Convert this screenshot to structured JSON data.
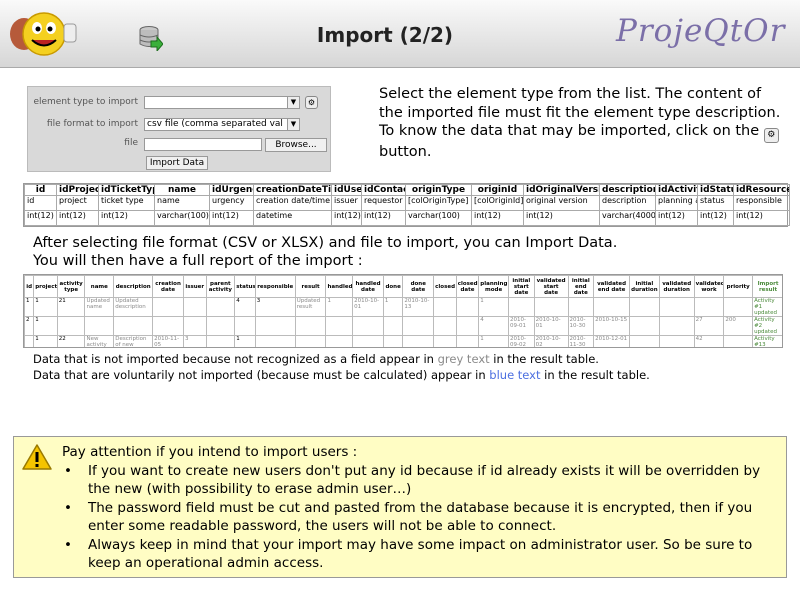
{
  "header": {
    "title": "Import (2/2)",
    "brand": "ProjeQtOr"
  },
  "form": {
    "element_type_label": "element type to import",
    "element_type_value": "",
    "file_format_label": "file format to import",
    "file_format_value": "csv file (comma separated val",
    "file_label": "file",
    "file_value": "",
    "browse_label": "Browse...",
    "import_label": "Import Data"
  },
  "intro": {
    "line1": "Select the element type from the list. The content of the imported file must fit the element type description.",
    "line2_prefix": "To know the data that may be imported, click on the",
    "line2_suffix": "button."
  },
  "desc_table": {
    "headers": [
      "id",
      "idProject",
      "idTicketType",
      "name",
      "idUrgency",
      "creationDateTime",
      "idUser",
      "idContact",
      "originType",
      "originId",
      "idOriginalVersion",
      "description",
      "idActivity",
      "idStatus",
      "idResource"
    ],
    "row1": [
      "id",
      "project",
      "ticket type",
      "name",
      "urgency",
      "creation date/time",
      "issuer",
      "requestor",
      "[colOriginType]",
      "[colOriginId]",
      "original version",
      "description",
      "planning activity",
      "status",
      "responsible"
    ],
    "row2": [
      "int(12)",
      "int(12)",
      "int(12)",
      "varchar(100)",
      "int(12)",
      "datetime",
      "int(12)",
      "int(12)",
      "varchar(100)",
      "int(12)",
      "int(12)",
      "varchar(4000)",
      "int(12)",
      "int(12)",
      "int(12)"
    ]
  },
  "para2": {
    "line1": "After selecting file format (CSV or XLSX) and file to import, you can Import Data.",
    "line2": "You will then have a full report of the import :"
  },
  "result_table": {
    "headers": [
      "id",
      "project",
      "activity type",
      "name",
      "description",
      "creation date",
      "issuer",
      "parent activity",
      "status",
      "responsible",
      "result",
      "handled",
      "handled date",
      "done",
      "done date",
      "closed",
      "closed date",
      "planning mode",
      "initial start date",
      "validated start date",
      "initial end date",
      "validated end date",
      "initial duration",
      "validated duration",
      "validated work",
      "priority",
      "Import result"
    ],
    "rows": [
      [
        "1",
        "1",
        "21",
        "Updated name",
        "Updated description",
        "",
        "",
        "",
        "4",
        "3",
        "Updated result",
        "1",
        "2010-10-01",
        "1",
        "2010-10-13",
        "",
        "",
        "1",
        "",
        "",
        "",
        "",
        "",
        "",
        "",
        "",
        "Activity #1 updated"
      ],
      [
        "2",
        "1",
        "",
        "",
        "",
        "",
        "",
        "",
        "",
        "",
        "",
        "",
        "",
        "",
        "",
        "",
        "",
        "4",
        "2010-09-01",
        "2010-10-01",
        "2010-10-30",
        "2010-10-15",
        "",
        "",
        "27",
        "200",
        "Activity #2 updated"
      ],
      [
        "",
        "1",
        "22",
        "New activity",
        "Description of new Activity",
        "2010-11-05",
        "3",
        "",
        "1",
        "",
        "",
        "",
        "",
        "",
        "",
        "",
        "",
        "1",
        "2010-09-02",
        "2010-10-02",
        "2010-11-30",
        "2010-12-01",
        "",
        "",
        "42",
        "",
        "Activity #13 inserted"
      ]
    ]
  },
  "notes": {
    "n1_pre": "Data that is not imported because not recognized as a field appear in",
    "n1_grey": "grey text",
    "n1_post": "in the result table.",
    "n2_pre": "Data that are voluntarily not imported (because must be calculated) appear in",
    "n2_blue": "blue text",
    "n2_post": "in the result table."
  },
  "warning": {
    "title": "Pay attention if you intend to import users :",
    "items": [
      "If you want to create new users don't put any id because if id already exists it will be overridden by the new (with possibility to erase admin user…)",
      "The password field must be cut and pasted from the database because it is encrypted, then if you enter some readable password, the users will not be able to connect.",
      "Always keep in mind that your import may have some impact on administrator user. So be sure to keep an operational admin access."
    ]
  },
  "colors": {
    "brand": "#7b6fa8",
    "grey_text": "#8a8a8a",
    "blue_text": "#4c6fe0",
    "warning_bg": "#fffdc4"
  }
}
